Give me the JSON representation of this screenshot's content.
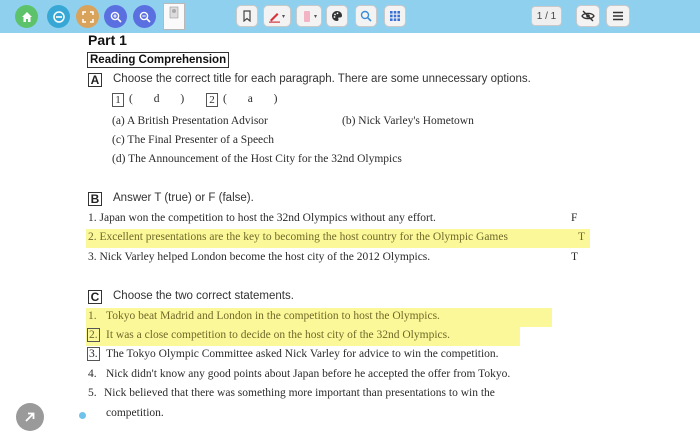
{
  "toolbar": {
    "icons": [
      "home-icon",
      "back-icon",
      "fit-icon",
      "zoom-in-icon",
      "zoom-out-icon",
      "thumbnail-icon",
      "bookmark-icon",
      "pen-icon",
      "marker-icon",
      "palette-icon",
      "search-icon",
      "grid-icon",
      "eye-off-icon",
      "menu-icon"
    ],
    "page_indicator": "1 / 1",
    "colors": {
      "bar": "#8fd0ef",
      "home": "#5cc36b",
      "back": "#37a8d5",
      "fit": "#d9a35b",
      "zoom": "#5a6fe0",
      "pen": "#d6333b",
      "marker": "#f2b3c4"
    }
  },
  "doc": {
    "part_title": "Part 1",
    "section_title": "Reading Comprehension",
    "A": {
      "label": "A",
      "instruction": "Choose the correct title for each paragraph. There are some unnecessary options.",
      "answers": [
        {
          "num": "1",
          "val": "( d )"
        },
        {
          "num": "2",
          "val": "( a )"
        }
      ],
      "options": [
        "(a) A British Presentation Advisor",
        "(b) Nick Varley's Hometown",
        "(c) The Final Presenter of a Speech",
        "(d) The Announcement of the Host City for the 32nd Olympics"
      ]
    },
    "B": {
      "label": "B",
      "instruction": "Answer T (true) or F (false).",
      "items": [
        {
          "text": "1.  Japan won the competition to host the 32nd Olympics without any effort.",
          "answer": "F"
        },
        {
          "text": "2.  Excellent presentations are the key to becoming the host country for the Olympic Games",
          "answer": "T"
        },
        {
          "text": "3.  Nick Varley helped London become the host city of the 2012 Olympics.",
          "answer": "T"
        }
      ]
    },
    "C": {
      "label": "C",
      "instruction": "Choose the two correct statements.",
      "items": [
        {
          "num": "1.",
          "text": "Tokyo beat Madrid and London in the competition to host the Olympics."
        },
        {
          "num": "2.",
          "text": "It was a close competition to decide on the host city of the 32nd Olympics."
        },
        {
          "num": "3.",
          "text": "The Tokyo Olympic Committee asked Nick Varley for advice to win the competition."
        },
        {
          "num": "4.",
          "text": "Nick didn't know any good points about Japan before he accepted the offer from Tokyo."
        },
        {
          "num": "5.",
          "text": "Nick believed that there was something more important than presentations to win the"
        },
        {
          "num": "",
          "text": "competition."
        }
      ]
    }
  }
}
